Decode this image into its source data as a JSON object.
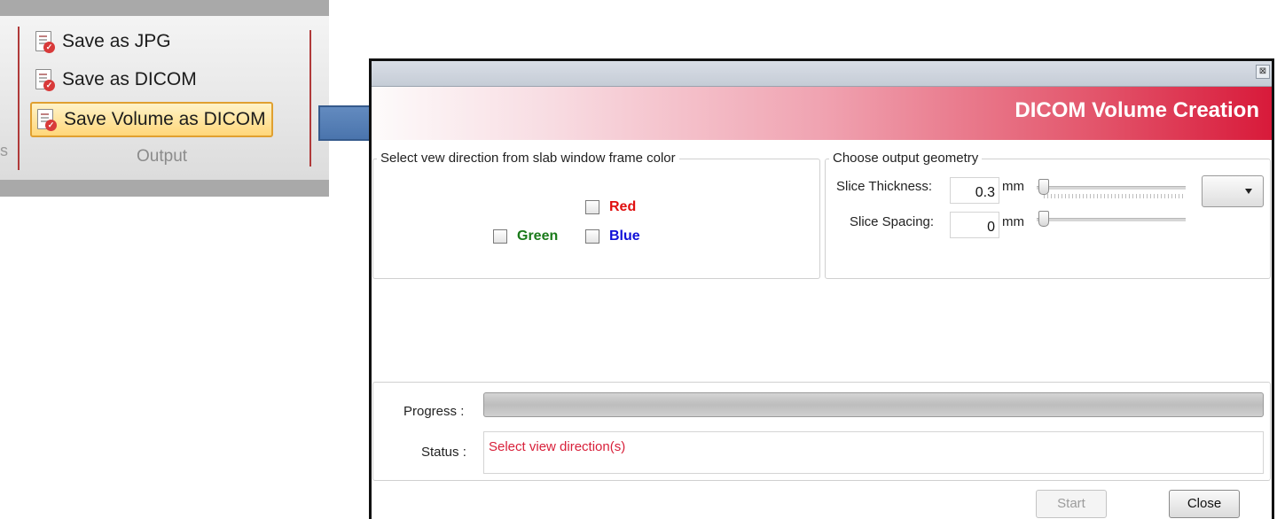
{
  "ribbon": {
    "buttons": [
      {
        "label": "Save as JPG"
      },
      {
        "label": "Save as DICOM"
      },
      {
        "label": "Save Volume as DICOM"
      }
    ],
    "group_label": "Output",
    "edge_text": "s"
  },
  "dialog": {
    "title": "DICOM Volume Creation",
    "close_glyph": "⊠",
    "view_direction": {
      "legend": "Select vew direction from slab window frame color",
      "options": [
        {
          "label": "Red",
          "color": "#e01010",
          "checked": false
        },
        {
          "label": "Green",
          "color": "#1a7a1a",
          "checked": false
        },
        {
          "label": "Blue",
          "color": "#1010d8",
          "checked": false
        }
      ]
    },
    "geometry": {
      "legend": "Choose output geometry",
      "thickness_label": "Slice Thickness:",
      "thickness_value": "0.3",
      "spacing_label": "Slice Spacing:",
      "spacing_value": "0",
      "unit": "mm"
    },
    "progress_label": "Progress :",
    "progress_value": 0,
    "status_label": "Status :",
    "status_text": "Select view direction(s)",
    "start_label": "Start",
    "close_label": "Close"
  },
  "colors": {
    "header_gradient_end": "#d81a3a",
    "status_text": "#d8203a",
    "ribbon_separator": "#b03a3a",
    "selected_highlight": "#ffd77a"
  }
}
